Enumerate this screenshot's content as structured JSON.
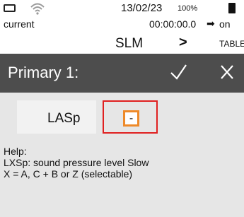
{
  "status_bar": {
    "date": "13/02/23",
    "battery_percent": "100%",
    "wifi_icon": "wifi-icon",
    "window_icon": "window-icon",
    "battery_icon": "battery-icon"
  },
  "top_bar": {
    "label": "current",
    "timer": "00:00:00.0",
    "arrow": "➡",
    "state": "on"
  },
  "nav": {
    "mode": "SLM",
    "next_symbol": ">",
    "next_mode": "TABLE"
  },
  "header": {
    "title": "Primary 1:",
    "ok_symbol": "✓",
    "close_symbol": "✕"
  },
  "param": {
    "label": "LASp",
    "value": "-"
  },
  "help": {
    "heading": "Help:",
    "line1": "LXSp: sound pressure level  Slow",
    "line2": "X = A, C + B or Z (selectable)"
  }
}
